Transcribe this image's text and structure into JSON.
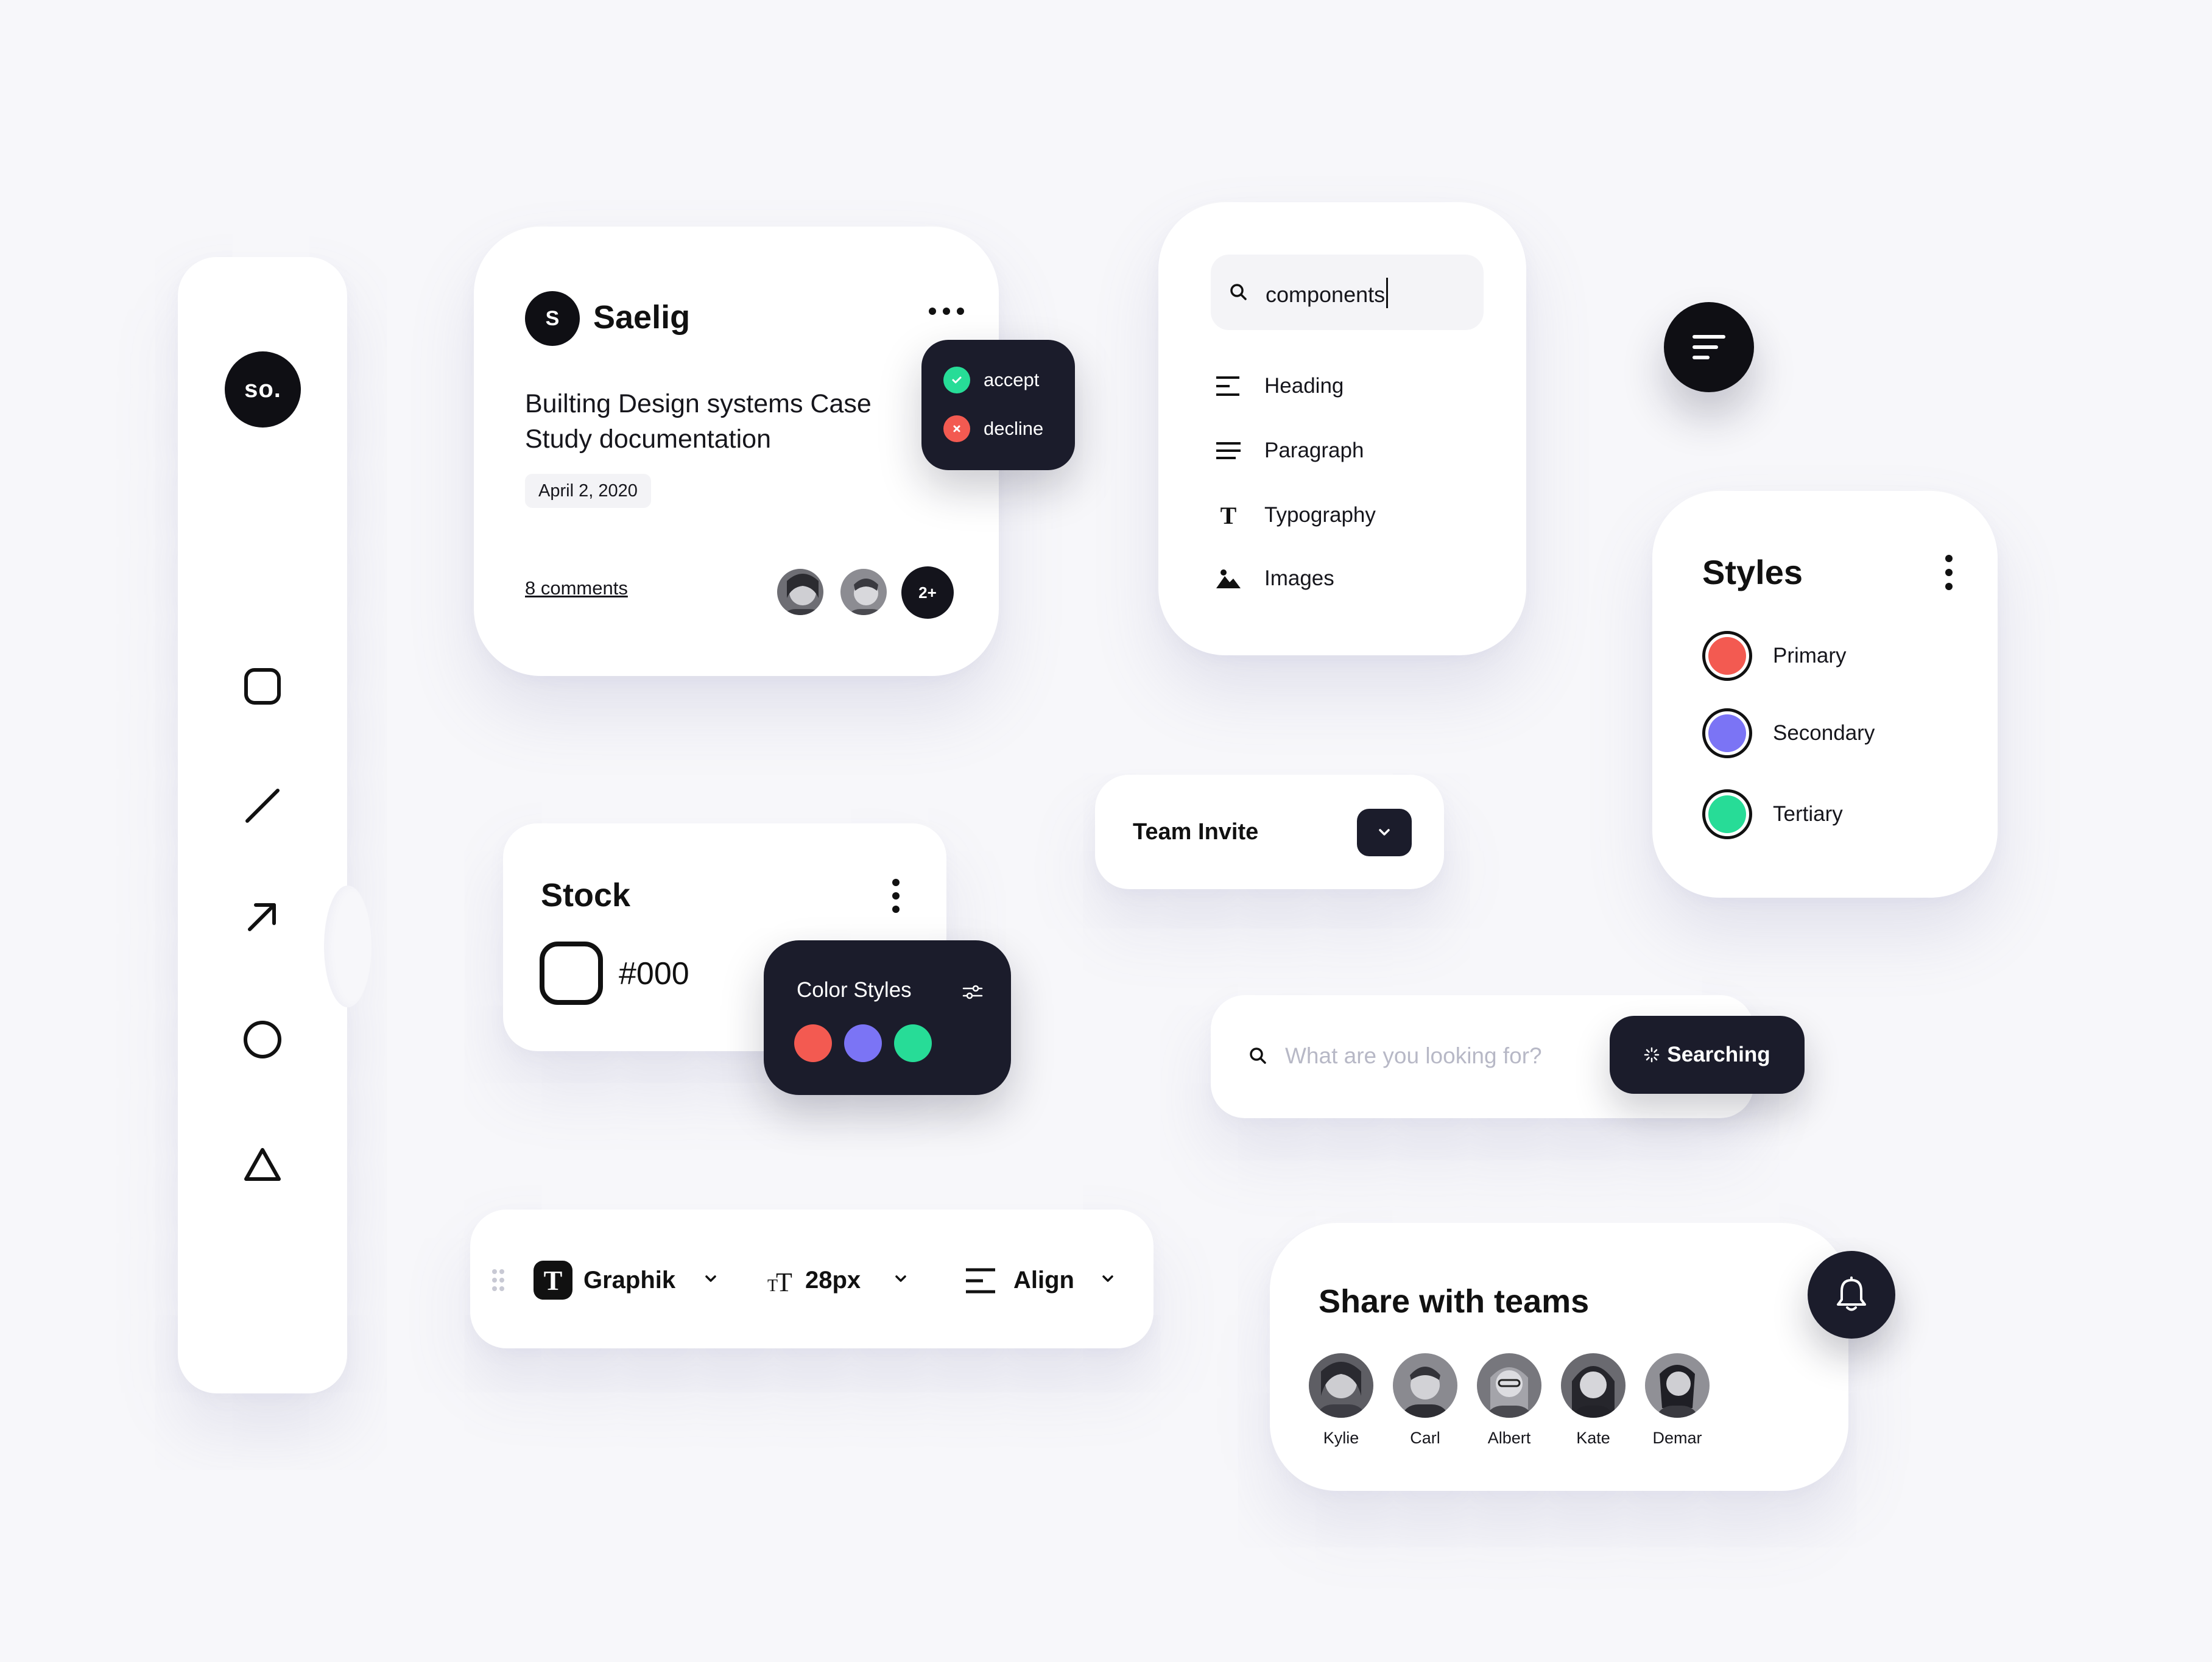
{
  "sidebar": {
    "logo": "so.",
    "tools": [
      "rectangle-tool",
      "line-tool",
      "arrow-tool",
      "ellipse-tool",
      "triangle-tool"
    ]
  },
  "post": {
    "avatar_letter": "S",
    "author": "Saelig",
    "title": "Builting Design systems Case Study documentation",
    "date": "April 2, 2020",
    "comments": "8 comments",
    "more_count": "2+"
  },
  "decision": {
    "accept": "accept",
    "decline": "decline"
  },
  "component_search": {
    "value": "components",
    "items": [
      {
        "label": "Heading",
        "icon": "heading-icon"
      },
      {
        "label": "Paragraph",
        "icon": "paragraph-icon"
      },
      {
        "label": "Typography",
        "icon": "typography-icon"
      },
      {
        "label": "Images",
        "icon": "image-icon"
      }
    ]
  },
  "styles": {
    "title": "Styles",
    "items": [
      {
        "label": "Primary",
        "color": "#f35a51"
      },
      {
        "label": "Secondary",
        "color": "#7b74f5"
      },
      {
        "label": "Tertiary",
        "color": "#27dc97"
      }
    ]
  },
  "team_invite": {
    "label": "Team Invite"
  },
  "stock": {
    "title": "Stock",
    "value": "#000"
  },
  "color_styles": {
    "title": "Color Styles",
    "colors": [
      "#f35a51",
      "#7b74f5",
      "#27dc97"
    ]
  },
  "search": {
    "placeholder": "What are you looking for?",
    "button": "Searching"
  },
  "toolbar": {
    "font_icon": "T",
    "font": "Graphik",
    "size": "28px",
    "align": "Align"
  },
  "share": {
    "title": "Share with teams",
    "members": [
      "Kylie",
      "Carl",
      "Albert",
      "Kate",
      "Demar"
    ]
  },
  "colors": {
    "dark": "#1b1c2b",
    "accent_red": "#f35a51",
    "accent_purple": "#7b74f5",
    "accent_green": "#27dc97"
  }
}
